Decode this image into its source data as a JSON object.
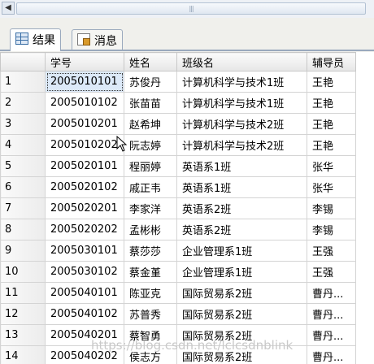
{
  "tabs": [
    {
      "label": "结果",
      "icon": "grid-icon",
      "active": true
    },
    {
      "label": "消息",
      "icon": "message-icon",
      "active": false
    }
  ],
  "columns": [
    "学号",
    "姓名",
    "班级名",
    "辅导员"
  ],
  "rows": [
    {
      "n": "1",
      "id": "2005010101",
      "name": "苏俊丹",
      "class": "计算机科学与技术1班",
      "advisor": "王艳"
    },
    {
      "n": "2",
      "id": "2005010102",
      "name": "张苗苗",
      "class": "计算机科学与技术1班",
      "advisor": "王艳"
    },
    {
      "n": "3",
      "id": "2005010201",
      "name": "赵希坤",
      "class": "计算机科学与技术2班",
      "advisor": "王艳"
    },
    {
      "n": "4",
      "id": "2005010202",
      "name": "阮志婷",
      "class": "计算机科学与技术2班",
      "advisor": "王艳"
    },
    {
      "n": "5",
      "id": "2005020101",
      "name": "程丽婷",
      "class": "英语系1班",
      "advisor": "张华"
    },
    {
      "n": "6",
      "id": "2005020102",
      "name": "戚正韦",
      "class": "英语系1班",
      "advisor": "张华"
    },
    {
      "n": "7",
      "id": "2005020201",
      "name": "李家洋",
      "class": "英语系2班",
      "advisor": "李锡"
    },
    {
      "n": "8",
      "id": "2005020202",
      "name": "孟彬彬",
      "class": "英语系2班",
      "advisor": "李锡"
    },
    {
      "n": "9",
      "id": "2005030101",
      "name": "蔡莎莎",
      "class": "企业管理系1班",
      "advisor": "王强"
    },
    {
      "n": "10",
      "id": "2005030102",
      "name": "蔡金堇",
      "class": "企业管理系1班",
      "advisor": "王强"
    },
    {
      "n": "11",
      "id": "2005040101",
      "name": "陈亚克",
      "class": "国际贸易系2班",
      "advisor": "曹丹..."
    },
    {
      "n": "12",
      "id": "2005040102",
      "name": "苏普秀",
      "class": "国际贸易系2班",
      "advisor": "曹丹..."
    },
    {
      "n": "13",
      "id": "2005040201",
      "name": "蔡智勇",
      "class": "国际贸易系2班",
      "advisor": "曹丹..."
    },
    {
      "n": "14",
      "id": "2005040202",
      "name": "侯志方",
      "class": "国际贸易系2班",
      "advisor": "曹丹..."
    }
  ],
  "watermark": "https://blog.csdn.net/lclcsdnblink"
}
